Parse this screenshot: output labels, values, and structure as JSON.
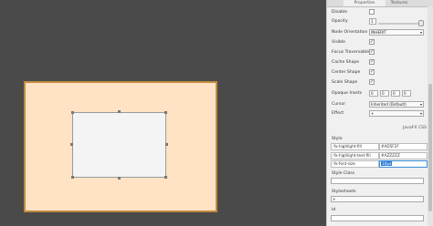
{
  "tabs": {
    "properties": "Properties",
    "textures": "Textures"
  },
  "props": {
    "disable": {
      "label": "Disable",
      "checked": false
    },
    "opacity": {
      "label": "Opacity",
      "value": "1",
      "level": 1.0
    },
    "node_orientation": {
      "label": "Node Orientation",
      "value": "INHERIT"
    },
    "visible": {
      "label": "Visible",
      "checked": true
    },
    "focus_traversable": {
      "label": "Focus Traversable",
      "checked": true
    },
    "cache_shape": {
      "label": "Cache Shape",
      "checked": true
    },
    "center_shape": {
      "label": "Center Shape",
      "checked": true
    },
    "scale_shape": {
      "label": "Scale Shape",
      "checked": true
    },
    "opaque_insets": {
      "label": "Opaque Insets",
      "values": [
        "0",
        "0",
        "0",
        "0"
      ]
    },
    "cursor": {
      "label": "Cursor",
      "value": "Inherited (Default)"
    },
    "effect": {
      "label": "Effect",
      "value": "+"
    }
  },
  "javafx_css": "JavaFX CSS",
  "style": {
    "label": "Style",
    "rows": [
      {
        "property": "-fx-highlight-fill",
        "value": "#AD5F2F"
      },
      {
        "property": "-fx-highlight-text-fill",
        "value": "#AZZZZZ"
      },
      {
        "property": "-fx-font-size",
        "value": "10px"
      }
    ]
  },
  "style_class": {
    "label": "Style Class",
    "value": ""
  },
  "stylesheets": {
    "label": "Stylesheets",
    "value": "+"
  },
  "id": {
    "label": "Id",
    "value": ""
  },
  "check_glyph": "✓",
  "dropdown_glyph": "▾",
  "colors": {
    "canvas": "#4a4a4a",
    "frame_fill": "#ffe3c4",
    "frame_border": "#c08a3e",
    "selection": "#2a7ad6"
  }
}
